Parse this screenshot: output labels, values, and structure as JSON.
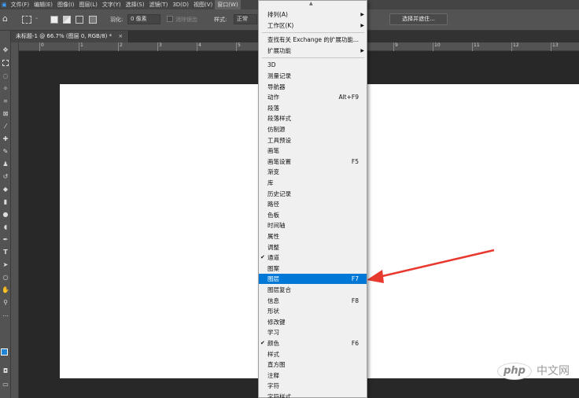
{
  "menubar": {
    "items": [
      "文件(F)",
      "编辑(E)",
      "图像(I)",
      "图层(L)",
      "文字(Y)",
      "选择(S)",
      "滤镜(T)",
      "3D(D)",
      "视图(V)",
      "窗口(W)"
    ],
    "active_index": 9
  },
  "options": {
    "feather_label": "羽化:",
    "feather_value": "0 像素",
    "antialias_label": "消除锯齿",
    "style_label": "样式:",
    "style_value": "正常",
    "select_mask_label": "选择并遮住..."
  },
  "document": {
    "tab_title": "未标题-1 @ 66.7% (图层 0, RGB/8) *",
    "close_icon": "close-icon"
  },
  "ruler": {
    "labels": [
      "0",
      "1",
      "2",
      "3",
      "4",
      "5",
      "6",
      "7",
      "8",
      "9",
      "10",
      "11",
      "12",
      "13",
      "14"
    ]
  },
  "window_menu": {
    "top_items": [
      {
        "label": "排列(A)",
        "submenu": true
      },
      {
        "label": "工作区(K)",
        "submenu": true
      }
    ],
    "ext_items": [
      {
        "label": "查找有关 Exchange 的扩展功能...",
        "submenu": false
      },
      {
        "label": "扩展功能",
        "submenu": true
      }
    ],
    "panel_items": [
      {
        "label": "3D",
        "shortcut": "",
        "checked": false
      },
      {
        "label": "测量记录",
        "shortcut": "",
        "checked": false
      },
      {
        "label": "导航器",
        "shortcut": "",
        "checked": false
      },
      {
        "label": "动作",
        "shortcut": "Alt+F9",
        "checked": false
      },
      {
        "label": "段落",
        "shortcut": "",
        "checked": false
      },
      {
        "label": "段落样式",
        "shortcut": "",
        "checked": false
      },
      {
        "label": "仿制源",
        "shortcut": "",
        "checked": false
      },
      {
        "label": "工具预设",
        "shortcut": "",
        "checked": false
      },
      {
        "label": "画笔",
        "shortcut": "",
        "checked": false
      },
      {
        "label": "画笔设置",
        "shortcut": "F5",
        "checked": false
      },
      {
        "label": "渐变",
        "shortcut": "",
        "checked": false
      },
      {
        "label": "库",
        "shortcut": "",
        "checked": false
      },
      {
        "label": "历史记录",
        "shortcut": "",
        "checked": false
      },
      {
        "label": "路径",
        "shortcut": "",
        "checked": false
      },
      {
        "label": "色板",
        "shortcut": "",
        "checked": false
      },
      {
        "label": "时间轴",
        "shortcut": "",
        "checked": false
      },
      {
        "label": "属性",
        "shortcut": "",
        "checked": false
      },
      {
        "label": "调整",
        "shortcut": "",
        "checked": false
      },
      {
        "label": "通道",
        "shortcut": "",
        "checked": true
      },
      {
        "label": "图案",
        "shortcut": "",
        "checked": false
      },
      {
        "label": "图层",
        "shortcut": "F7",
        "checked": false,
        "highlighted": true
      },
      {
        "label": "图层复合",
        "shortcut": "",
        "checked": false
      },
      {
        "label": "信息",
        "shortcut": "F8",
        "checked": false
      },
      {
        "label": "形状",
        "shortcut": "",
        "checked": false
      },
      {
        "label": "修改键",
        "shortcut": "",
        "checked": false
      },
      {
        "label": "学习",
        "shortcut": "",
        "checked": false
      },
      {
        "label": "颜色",
        "shortcut": "F6",
        "checked": true
      },
      {
        "label": "样式",
        "shortcut": "",
        "checked": false
      },
      {
        "label": "直方图",
        "shortcut": "",
        "checked": false
      },
      {
        "label": "注释",
        "shortcut": "",
        "checked": false
      },
      {
        "label": "字符",
        "shortcut": "",
        "checked": false
      },
      {
        "label": "字符样式",
        "shortcut": "",
        "checked": false
      }
    ]
  },
  "watermark": {
    "logo_text": "php",
    "site_text": "中文网"
  },
  "colors": {
    "highlight": "#0078d7",
    "arrow": "#e8392f",
    "foreground_swatch": "#1f84d6"
  }
}
